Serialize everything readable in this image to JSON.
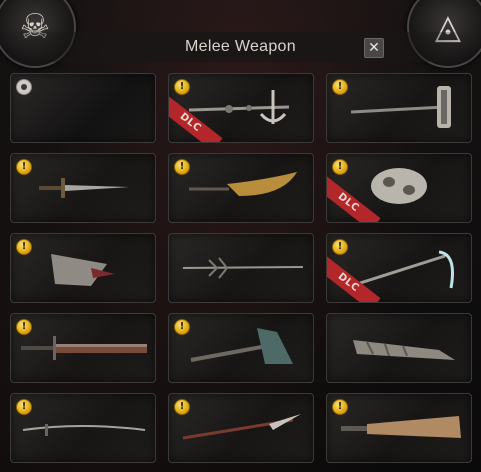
{
  "dialog": {
    "title": "Melee Weapon",
    "close_label": "✕"
  },
  "emblems": [
    {
      "name": "skull-emblem",
      "glyph": "☠"
    },
    {
      "name": "eye-triangle-emblem",
      "glyph": "◬"
    }
  ],
  "cards": [
    {
      "badge": "radio",
      "dlc": false,
      "weapon_icon": "none"
    },
    {
      "badge": "coin",
      "dlc": true,
      "dlc_label": "DLC",
      "weapon_icon": "anchor-staff-icon"
    },
    {
      "badge": "coin",
      "dlc": false,
      "weapon_icon": "halberd-icon"
    },
    {
      "badge": "coin",
      "dlc": false,
      "weapon_icon": "sword-icon"
    },
    {
      "badge": "coin",
      "dlc": false,
      "weapon_icon": "curved-blade-icon"
    },
    {
      "badge": "coin",
      "dlc": true,
      "dlc_label": "DLC",
      "weapon_icon": "gauntlet-icon"
    },
    {
      "badge": "coin",
      "dlc": false,
      "weapon_icon": "claw-gauntlet-icon"
    },
    {
      "badge": "coin",
      "dlc": false,
      "weapon_icon": "spiked-rapier-icon"
    },
    {
      "badge": "coin",
      "dlc": true,
      "dlc_label": "DLC",
      "weapon_icon": "scythe-icon"
    },
    {
      "badge": "coin",
      "dlc": false,
      "weapon_icon": "greatsword-icon"
    },
    {
      "badge": "coin",
      "dlc": false,
      "weapon_icon": "axe-icon"
    },
    {
      "badge": "none",
      "dlc": false,
      "weapon_icon": "claw-blade-icon"
    },
    {
      "badge": "coin",
      "dlc": false,
      "weapon_icon": "thin-katana-icon"
    },
    {
      "badge": "coin",
      "dlc": false,
      "weapon_icon": "spear-blade-icon"
    },
    {
      "badge": "coin",
      "dlc": false,
      "weapon_icon": "bone-greatsword-icon"
    }
  ],
  "badge_glyph": "!"
}
